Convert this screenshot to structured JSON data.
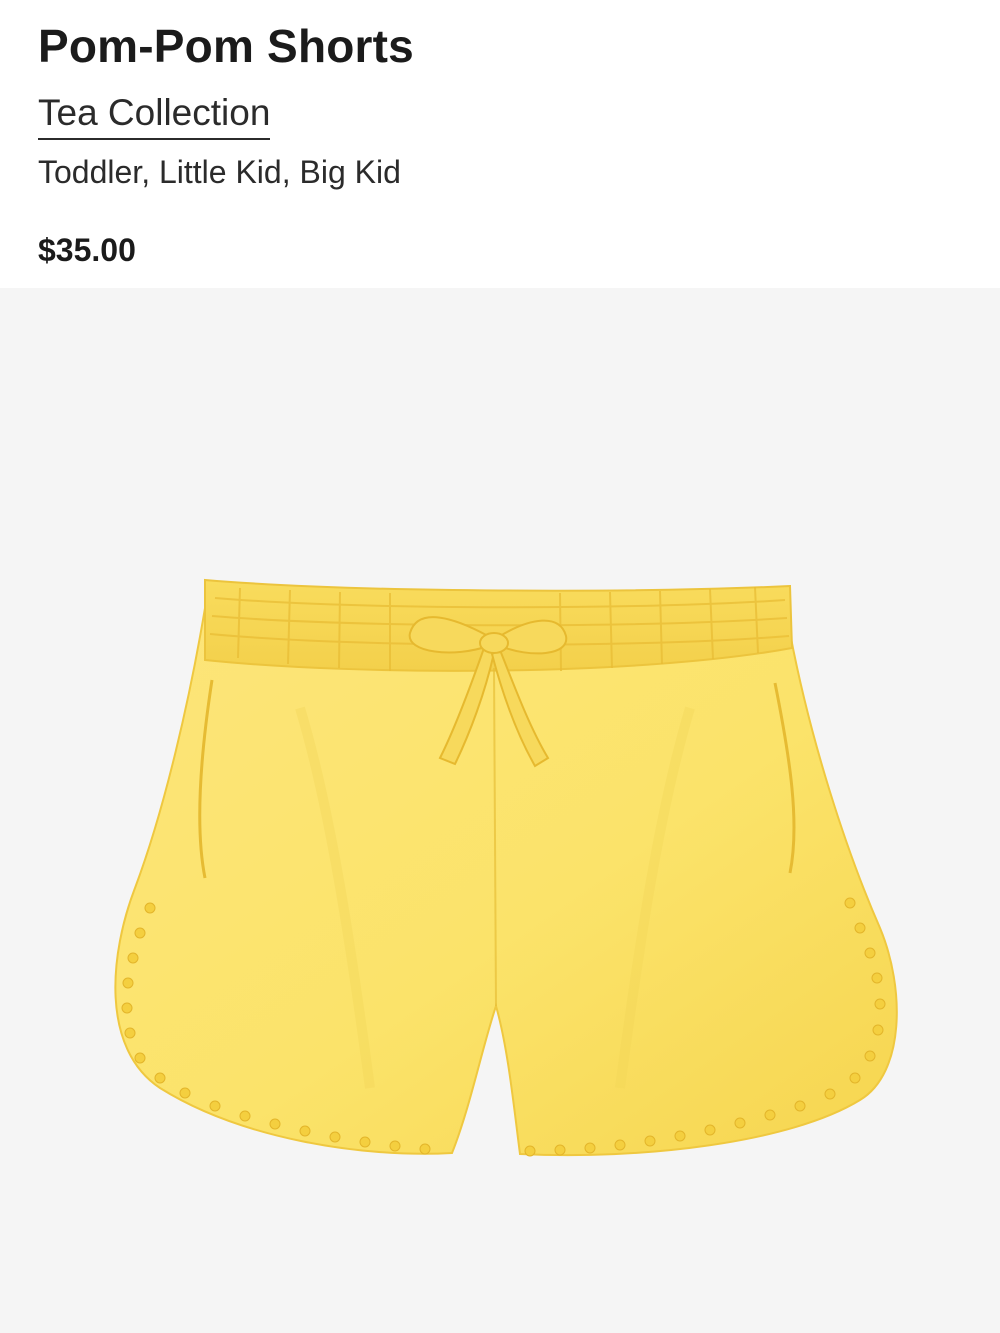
{
  "product": {
    "title": "Pom-Pom Shorts",
    "brand": "Tea Collection",
    "sizes": "Toddler, Little Kid, Big Kid",
    "price": "$35.00"
  },
  "image": {
    "subject": "yellow-pom-pom-shorts",
    "colors": {
      "background": "#f5f5f5",
      "fabric": "#fbe46e",
      "fabric_shadow": "#f2cf45",
      "trim": "#f4cf3f"
    }
  }
}
